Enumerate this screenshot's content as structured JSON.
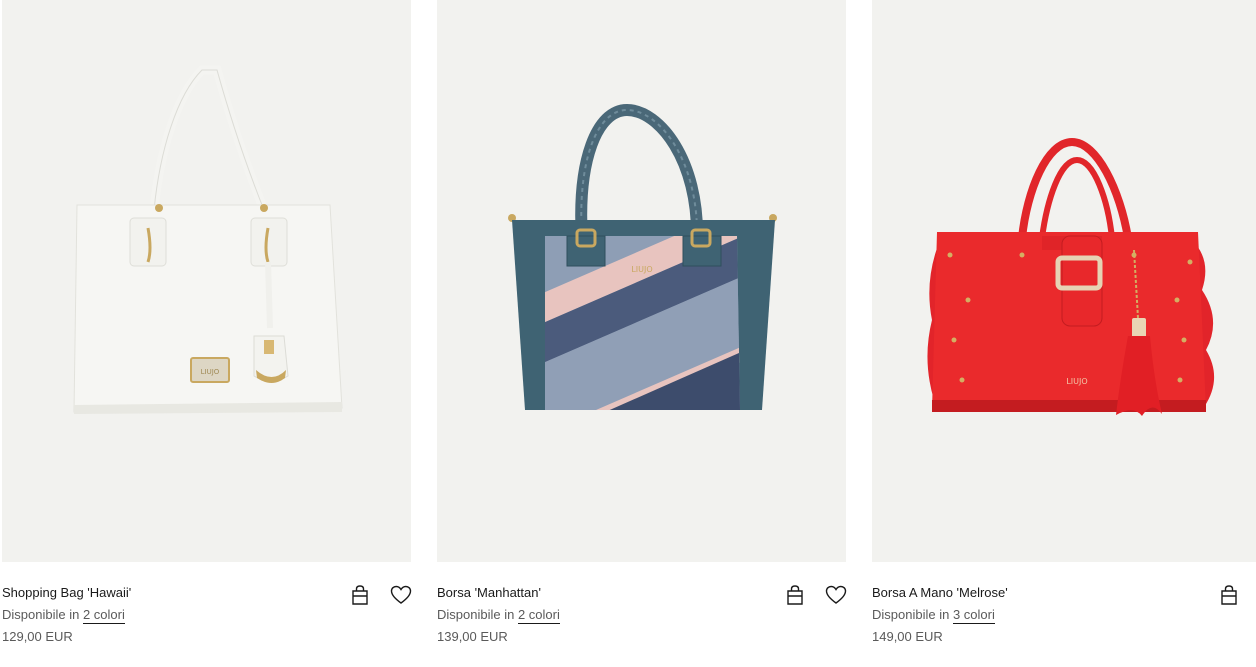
{
  "products": [
    {
      "name": "Shopping Bag 'Hawaii'",
      "availability_prefix": "Disponibile in",
      "colors_link": "2 colori",
      "price": "129,00 EUR",
      "image_icon": "white-tote-bag-image",
      "actions": [
        "shopping-bag-icon",
        "heart-icon"
      ]
    },
    {
      "name": "Borsa 'Manhattan'",
      "availability_prefix": "Disponibile in",
      "colors_link": "2 colori",
      "price": "139,00 EUR",
      "image_icon": "blue-striped-handbag-image",
      "actions": [
        "shopping-bag-icon",
        "heart-icon"
      ]
    },
    {
      "name": "Borsa A Mano 'Melrose'",
      "availability_prefix": "Disponibile in",
      "colors_link": "3 colori",
      "price": "149,00 EUR",
      "image_icon": "red-ruffle-handbag-image",
      "actions": [
        "shopping-bag-icon"
      ]
    }
  ],
  "image_logos": [
    "LIUJO",
    "LIUJO",
    "LIUJO"
  ],
  "colors": {
    "image_background": "#f2f2ef",
    "text_primary": "#1a1a1a",
    "text_secondary": "#5a5a5a",
    "bag_white": "#f7f7f4",
    "bag_teal": "#3f6373",
    "bag_red": "#ea2a2c"
  }
}
